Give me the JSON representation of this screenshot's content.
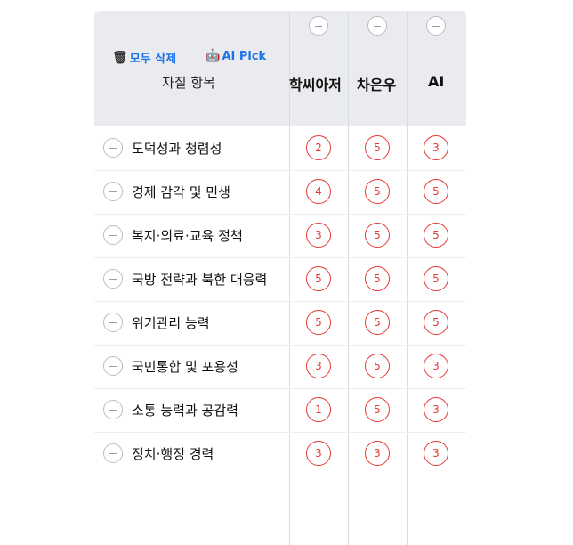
{
  "toolbar": {
    "delete_all": "모두 삭제",
    "ai_pick": "AI Pick"
  },
  "table": {
    "item_header": "자질 항목",
    "columns": [
      "학씨아저",
      "차은우",
      "AI"
    ],
    "rows": [
      {
        "label": "도덕성과 청렴성",
        "scores": [
          "2",
          "5",
          "3"
        ]
      },
      {
        "label": "경제 감각 및 민생",
        "scores": [
          "4",
          "5",
          "5"
        ]
      },
      {
        "label": "복지·의료·교육 정책",
        "scores": [
          "3",
          "5",
          "5"
        ]
      },
      {
        "label": "국방 전략과 북한 대응력",
        "scores": [
          "5",
          "5",
          "5"
        ]
      },
      {
        "label": "위기관리 능력",
        "scores": [
          "5",
          "5",
          "5"
        ]
      },
      {
        "label": "국민통합 및 포용성",
        "scores": [
          "3",
          "5",
          "3"
        ]
      },
      {
        "label": "소통 능력과 공감력",
        "scores": [
          "1",
          "5",
          "3"
        ]
      },
      {
        "label": "정치·행정 경력",
        "scores": [
          "3",
          "3",
          "3"
        ]
      }
    ]
  },
  "colors": {
    "score": "#e53935",
    "link": "#1a73e8",
    "header_bg": "#e9ebee"
  }
}
